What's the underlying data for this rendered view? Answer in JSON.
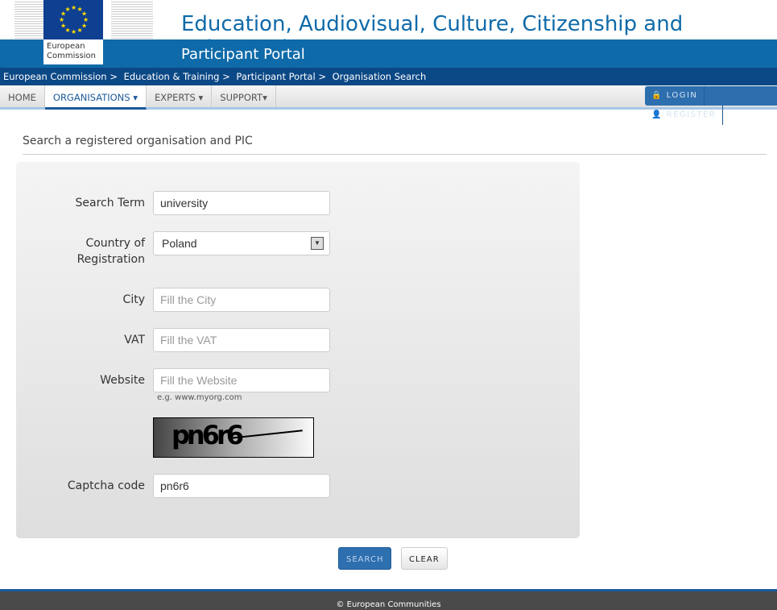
{
  "header": {
    "logo_text_1": "European",
    "logo_text_2": "Commission",
    "title": "Education, Audiovisual, Culture, Citizenship and Volunteering",
    "subtitle": "Participant Portal"
  },
  "breadcrumb": [
    "European Commission >",
    "Education & Training >",
    "Participant Portal >",
    "Organisation Search"
  ],
  "nav": {
    "items": [
      "HOME",
      "ORGANISATIONS ▾",
      "EXPERTS ▾",
      "SUPPORT▾"
    ],
    "active": "ORGANISATIONS",
    "login": "LOGIN",
    "register": "REGISTER"
  },
  "section_title": "Search a registered organisation and PIC",
  "form": {
    "search_term": {
      "label": "Search Term",
      "value": "university"
    },
    "country": {
      "label_1": "Country of",
      "label_2": "Registration",
      "value": "Poland"
    },
    "city": {
      "label": "City",
      "placeholder": "Fill the City"
    },
    "vat": {
      "label": "VAT",
      "placeholder": "Fill the VAT"
    },
    "website": {
      "label": "Website",
      "placeholder": "Fill the Website",
      "hint": "e.g. www.myorg.com"
    },
    "captcha_image_text": "pn6r6",
    "captcha": {
      "label": "Captcha code",
      "value": "pn6r6"
    }
  },
  "buttons": {
    "search": "SEARCH",
    "clear": "CLEAR"
  },
  "footer": "© European Communities"
}
